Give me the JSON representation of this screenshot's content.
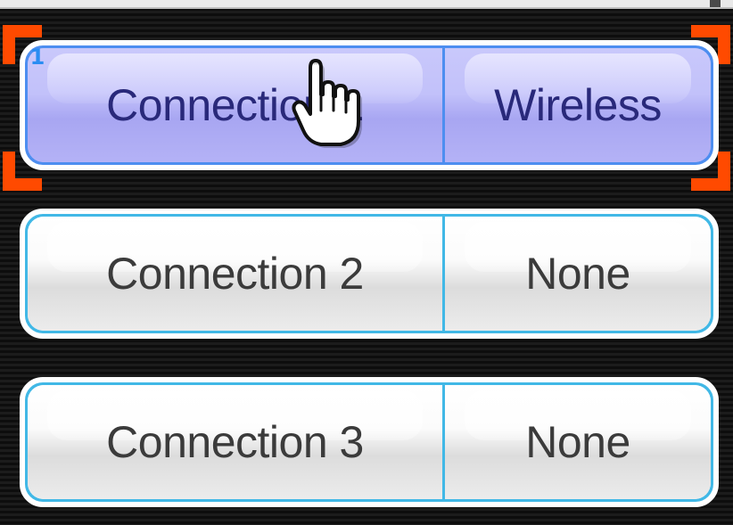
{
  "connections": [
    {
      "name": "Connection 1",
      "type": "Wireless",
      "selected": true
    },
    {
      "name": "Connection 2",
      "type": "None",
      "selected": false
    },
    {
      "name": "Connection 3",
      "type": "None",
      "selected": false
    }
  ],
  "cursor": {
    "icon": "hand-pointer-icon",
    "player_number": "1"
  },
  "colors": {
    "selected_fill": "#b8b6f7",
    "selected_border": "#4d8ef0",
    "row_border": "#41b8e6",
    "selection_bracket": "#ff4a00",
    "text": "#3b3b3b",
    "selected_text": "#29297a"
  }
}
